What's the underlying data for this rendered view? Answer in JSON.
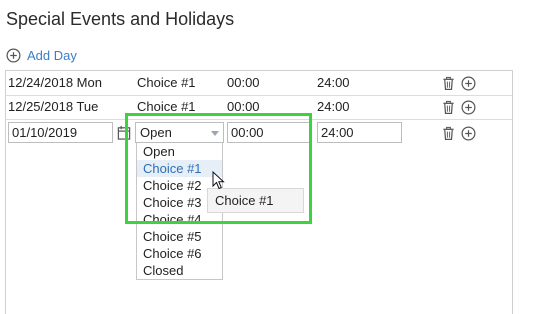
{
  "page": {
    "title": "Special Events and Holidays"
  },
  "add_day": {
    "icon": "plus-circle-icon",
    "label": "Add Day"
  },
  "rows": [
    {
      "date": "12/24/2018 Mon",
      "choice": "Choice #1",
      "start": "00:00",
      "end": "24:00"
    },
    {
      "date": "12/25/2018 Tue",
      "choice": "Choice #1",
      "start": "00:00",
      "end": "24:00"
    }
  ],
  "edit_row": {
    "date": "01/10/2019",
    "selected": "Open",
    "start": "00:00",
    "end": "24:00"
  },
  "dropdown": {
    "options": [
      "Open",
      "Choice #1",
      "Choice #2",
      "Choice #3",
      "Choice #4",
      "Choice #5",
      "Choice #6",
      "Closed"
    ],
    "hovered": "Choice #1"
  },
  "tooltip": {
    "text": "Choice #1"
  },
  "colors": {
    "accent": "#3a7dc9",
    "highlight": "#3ed23e",
    "hover_bg": "#e6eef7"
  }
}
